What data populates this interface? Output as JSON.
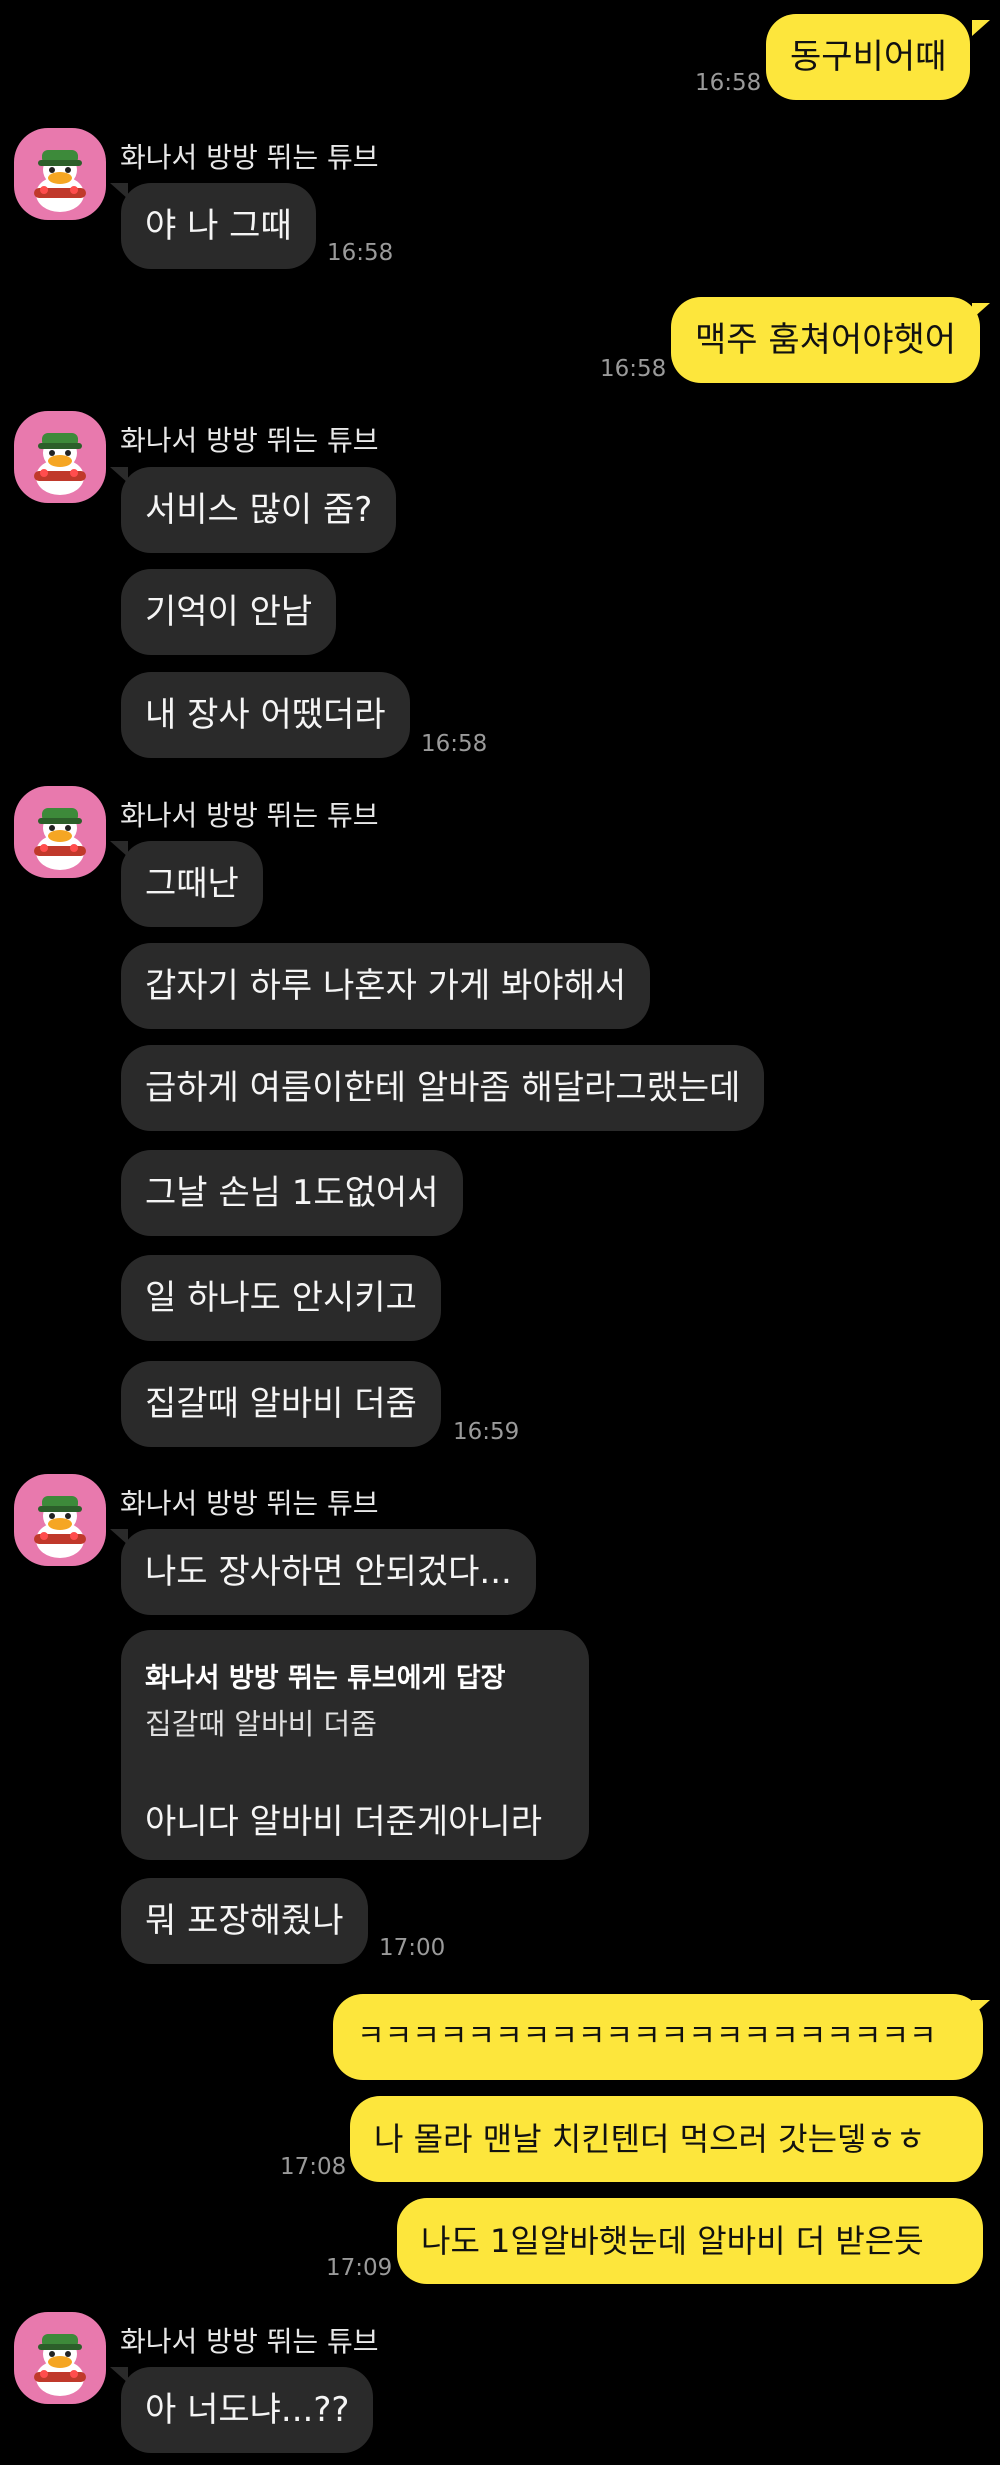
{
  "sender_name": "화나서 방방 뛰는 튜브",
  "avatar_icon": "duck-character-icon",
  "colors": {
    "outgoing": "#fde63c",
    "incoming": "#2a2a2a",
    "background": "#000000"
  },
  "messages": {
    "m1": {
      "text": "동구비어때",
      "time": "16:58"
    },
    "m2": {
      "text": "야 나 그때",
      "time": "16:58"
    },
    "m3": {
      "text": "맥주 훔쳐어야햇어",
      "time": "16:58"
    },
    "m4": {
      "text": "서비스 많이 줌?"
    },
    "m5": {
      "text": "기억이 안남"
    },
    "m6": {
      "text": "내 장사 어땠더라",
      "time": "16:58"
    },
    "m7": {
      "text": "그때난"
    },
    "m8": {
      "text": "갑자기 하루 나혼자 가게 봐야해서"
    },
    "m9": {
      "text": "급하게 여름이한테 알바좀 해달라그랬는데"
    },
    "m10": {
      "text": "그날 손님 1도없어서"
    },
    "m11": {
      "text": "일 하나도 안시키고"
    },
    "m12": {
      "text": "집갈때 알바비 더줌",
      "time": "16:59"
    },
    "m13": {
      "text": "나도 장사하면 안되겄다..."
    },
    "m14": {
      "reply_header": "화나서 방방 뛰는 튜브에게 답장",
      "quoted": "집갈때 알바비 더줌",
      "text": "아니다 알바비 더준게아니라"
    },
    "m15": {
      "text": "뭐 포장해줬나",
      "time": "17:00"
    },
    "m16": {
      "text": "ㅋㅋㅋㅋㅋㅋㅋㅋㅋㅋㅋㅋㅋㅋㅋㅋㅋㅋㅋㅋㅋ"
    },
    "m17": {
      "text": "나 몰라 맨날 치킨텐더 먹으러 갓는뎋ㅎㅎ",
      "time": "17:08"
    },
    "m18": {
      "text": "나도 1일알바햇눈데 알바비 더 받은듯",
      "time": "17:09"
    },
    "m19": {
      "text": "아 너도냐...??"
    }
  }
}
